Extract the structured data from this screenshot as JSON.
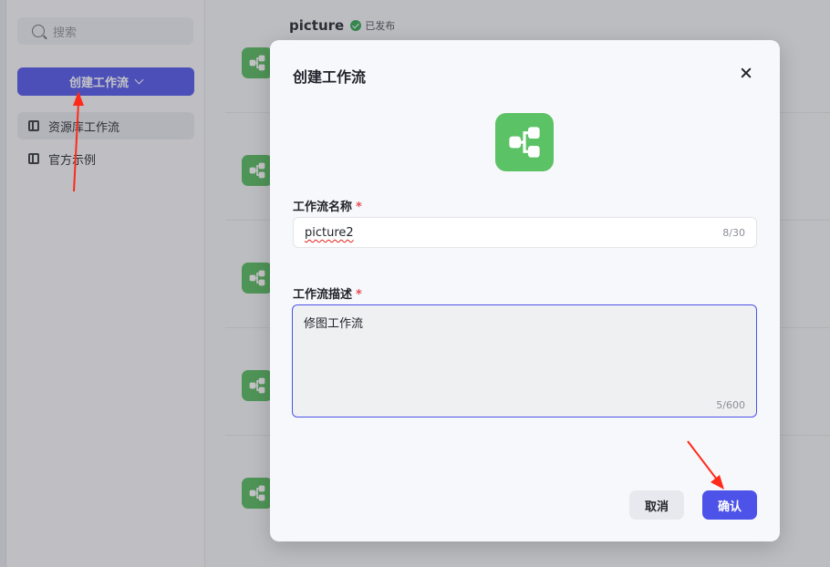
{
  "sidebar": {
    "search_placeholder": "搜索",
    "create_button": "创建工作流",
    "nav": [
      {
        "label": "资源库工作流"
      },
      {
        "label": "官方示例"
      }
    ]
  },
  "list": {
    "first_item_title": "picture",
    "first_item_status": "已发布"
  },
  "modal": {
    "title": "创建工作流",
    "name_label": "工作流名称",
    "required_mark": "*",
    "name_value": "picture2",
    "name_counter": "8/30",
    "desc_label": "工作流描述",
    "desc_value": "修图工作流",
    "desc_counter": "5/600",
    "cancel_label": "取消",
    "confirm_label": "确认"
  },
  "colors": {
    "accent": "#4d53e8",
    "workflow_icon": "#5cc266",
    "required": "#e34d59",
    "annotation_arrow": "#ff2a1a"
  }
}
